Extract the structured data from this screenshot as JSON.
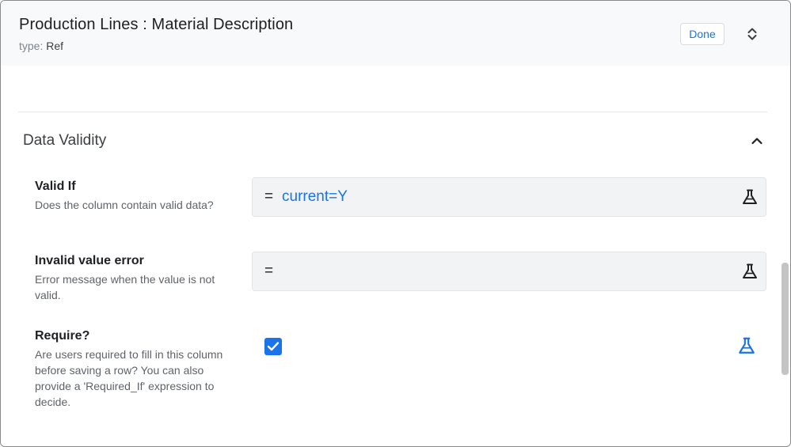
{
  "header": {
    "title": "Production Lines : Material Description",
    "type_key": "type:",
    "type_value": "Ref",
    "done_label": "Done"
  },
  "section": {
    "title": "Data Validity"
  },
  "fields": [
    {
      "label": "Valid If",
      "description": "Does the column contain valid data?",
      "eq": "=",
      "expression": "current=Y"
    },
    {
      "label": "Invalid value error",
      "description": "Error message when the value is not valid.",
      "eq": "=",
      "expression": ""
    },
    {
      "label": "Require?",
      "description": "Are users required to fill in this column before saving a row? You can also provide a 'Required_If' expression to decide.",
      "checked": true
    }
  ],
  "icons": {
    "expand": "unfold-more-icon",
    "collapse": "chevron-up-icon",
    "flask": "flask-icon",
    "checkbox": "check-icon"
  },
  "colors": {
    "accent": "#1a73e8",
    "header_bg": "#f8f9fa",
    "field_bg": "#f1f3f4"
  }
}
